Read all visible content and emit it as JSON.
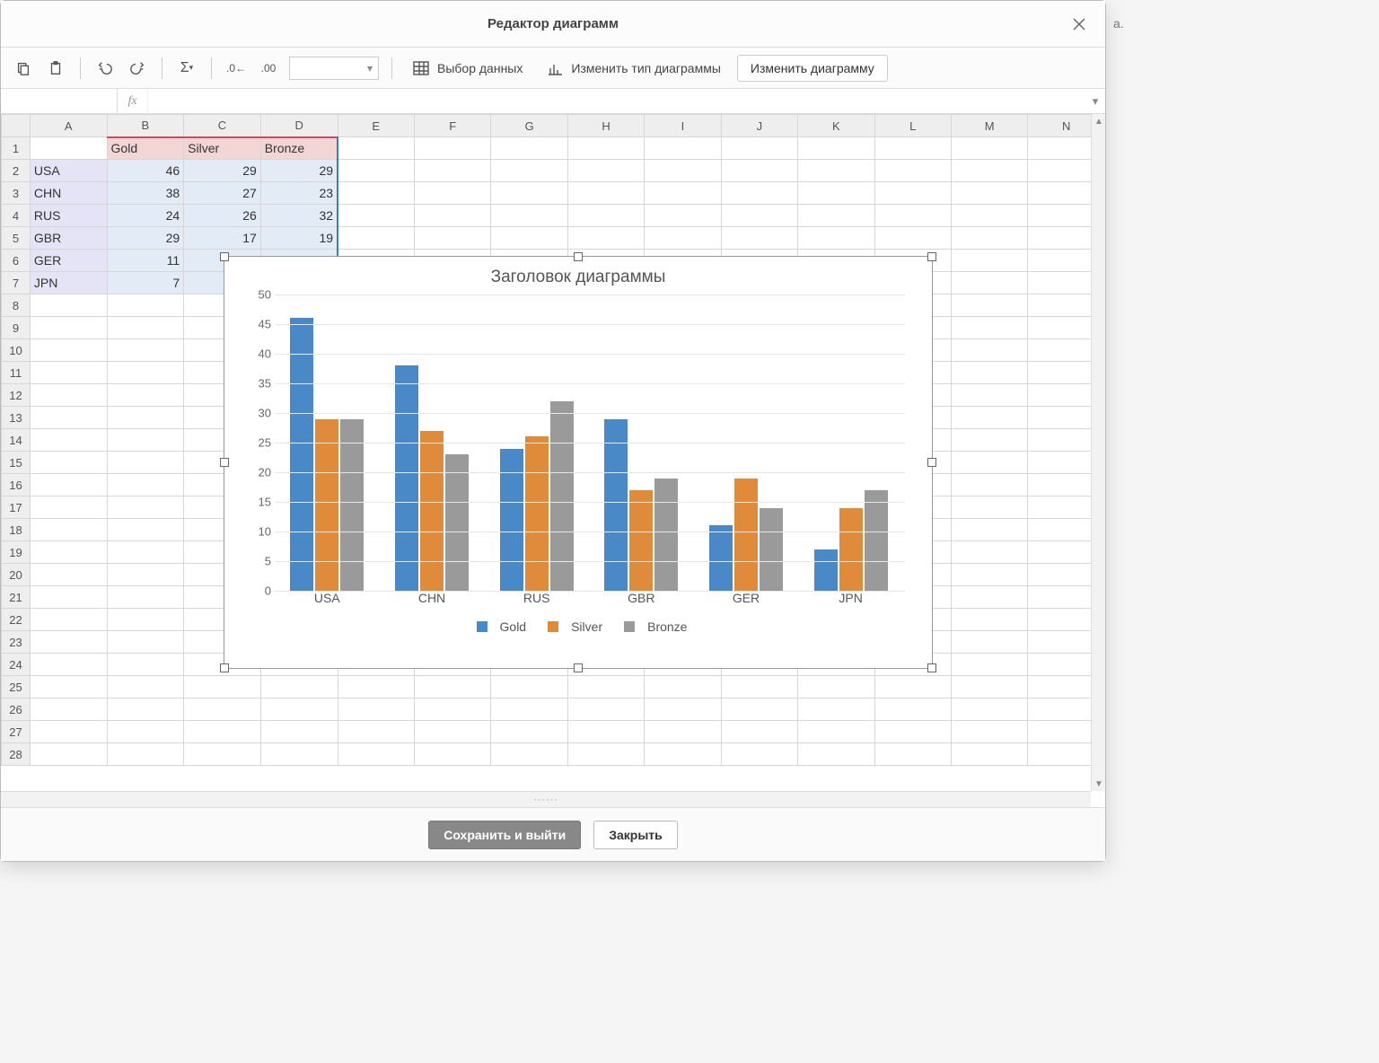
{
  "dialog": {
    "title": "Редактор диаграмм"
  },
  "toolbar": {
    "select_data": "Выбор данных",
    "change_type": "Изменить тип диаграммы",
    "edit_chart": "Изменить диаграмму",
    "fx": "fx"
  },
  "columns": [
    "A",
    "B",
    "C",
    "D",
    "E",
    "F",
    "G",
    "H",
    "I",
    "J",
    "K",
    "L",
    "M",
    "N"
  ],
  "row_numbers": [
    1,
    2,
    3,
    4,
    5,
    6,
    7,
    8,
    9,
    10,
    11,
    12,
    13,
    14,
    15,
    16,
    17,
    18,
    19,
    20,
    21,
    22,
    23,
    24,
    25,
    26,
    27,
    28
  ],
  "sheet": {
    "headers": [
      "Gold",
      "Silver",
      "Bronze"
    ],
    "rows": [
      {
        "label": "USA",
        "vals": [
          46,
          29,
          29
        ]
      },
      {
        "label": "CHN",
        "vals": [
          38,
          27,
          23
        ]
      },
      {
        "label": "RUS",
        "vals": [
          24,
          26,
          32
        ]
      },
      {
        "label": "GBR",
        "vals": [
          29,
          17,
          19
        ]
      },
      {
        "label": "GER",
        "vals": [
          11,
          "",
          ""
        ]
      },
      {
        "label": "JPN",
        "vals": [
          7,
          "",
          ""
        ]
      }
    ]
  },
  "chart_data": {
    "type": "bar",
    "title": "Заголовок диаграммы",
    "categories": [
      "USA",
      "CHN",
      "RUS",
      "GBR",
      "GER",
      "JPN"
    ],
    "series": [
      {
        "name": "Gold",
        "color": "#4a89c8",
        "values": [
          46,
          38,
          24,
          29,
          11,
          7
        ]
      },
      {
        "name": "Silver",
        "color": "#e08b3a",
        "values": [
          29,
          27,
          26,
          17,
          19,
          14
        ]
      },
      {
        "name": "Bronze",
        "color": "#9a9a9a",
        "values": [
          29,
          23,
          32,
          19,
          14,
          17
        ]
      }
    ],
    "ylim": [
      0,
      50
    ],
    "yticks": [
      0,
      5,
      10,
      15,
      20,
      25,
      30,
      35,
      40,
      45,
      50
    ],
    "xlabel": "",
    "ylabel": ""
  },
  "footer": {
    "save_exit": "Сохранить и выйти",
    "close": "Закрыть"
  },
  "edge_text": "a."
}
